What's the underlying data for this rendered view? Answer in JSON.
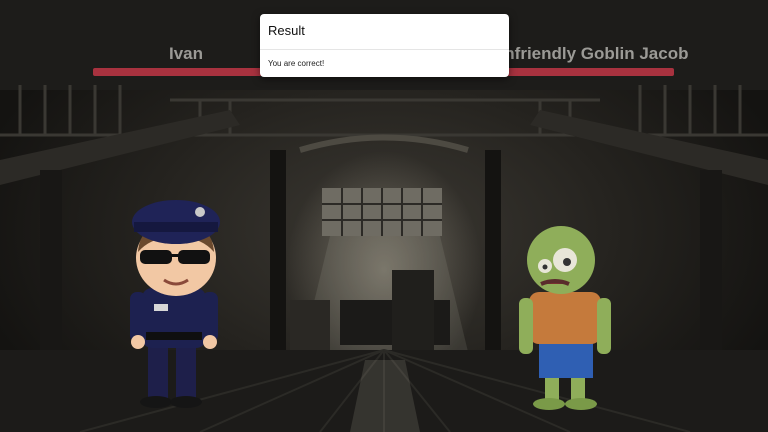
{
  "hud": {
    "player": {
      "name": "Ivan",
      "health_fraction": 1.0
    },
    "enemy": {
      "name": "Unfriendly Goblin Jacob",
      "health_fraction": 1.0
    },
    "health_color": "#a8323f"
  },
  "modal": {
    "title": "Result",
    "message": "You are correct!"
  },
  "characters": {
    "player_icon": "police-officer",
    "enemy_icon": "green-zombie"
  }
}
